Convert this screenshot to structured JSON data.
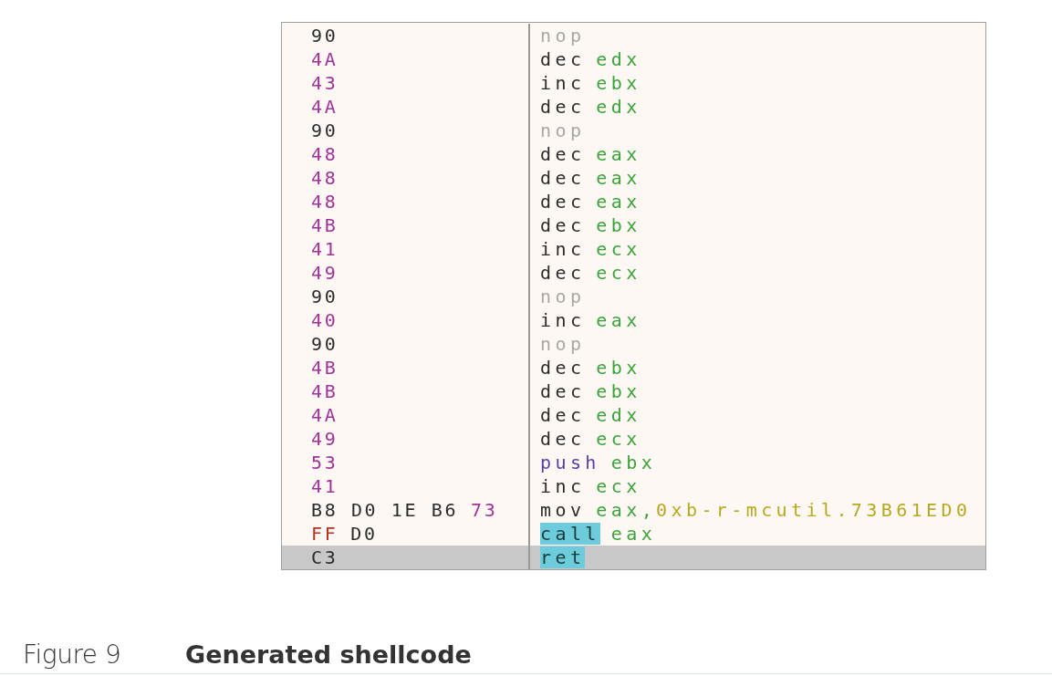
{
  "disassembly": {
    "rows": [
      {
        "bytes": [
          {
            "text": "90",
            "color": "#2b2b2b"
          }
        ],
        "mnemonic": {
          "text": "nop",
          "color": "#a8a8a8",
          "highlighted": false
        },
        "operands": [],
        "selected": false
      },
      {
        "bytes": [
          {
            "text": "4A",
            "color": "#a0329a"
          }
        ],
        "mnemonic": {
          "text": "dec",
          "color": "#2b2b2b",
          "highlighted": false
        },
        "operands": [
          {
            "text": "edx",
            "color": "#3aa43a"
          }
        ],
        "selected": false
      },
      {
        "bytes": [
          {
            "text": "43",
            "color": "#a0329a"
          }
        ],
        "mnemonic": {
          "text": "inc",
          "color": "#2b2b2b",
          "highlighted": false
        },
        "operands": [
          {
            "text": "ebx",
            "color": "#3aa43a"
          }
        ],
        "selected": false
      },
      {
        "bytes": [
          {
            "text": "4A",
            "color": "#a0329a"
          }
        ],
        "mnemonic": {
          "text": "dec",
          "color": "#2b2b2b",
          "highlighted": false
        },
        "operands": [
          {
            "text": "edx",
            "color": "#3aa43a"
          }
        ],
        "selected": false
      },
      {
        "bytes": [
          {
            "text": "90",
            "color": "#2b2b2b"
          }
        ],
        "mnemonic": {
          "text": "nop",
          "color": "#a8a8a8",
          "highlighted": false
        },
        "operands": [],
        "selected": false
      },
      {
        "bytes": [
          {
            "text": "48",
            "color": "#a0329a"
          }
        ],
        "mnemonic": {
          "text": "dec",
          "color": "#2b2b2b",
          "highlighted": false
        },
        "operands": [
          {
            "text": "eax",
            "color": "#3aa43a"
          }
        ],
        "selected": false
      },
      {
        "bytes": [
          {
            "text": "48",
            "color": "#a0329a"
          }
        ],
        "mnemonic": {
          "text": "dec",
          "color": "#2b2b2b",
          "highlighted": false
        },
        "operands": [
          {
            "text": "eax",
            "color": "#3aa43a"
          }
        ],
        "selected": false
      },
      {
        "bytes": [
          {
            "text": "48",
            "color": "#a0329a"
          }
        ],
        "mnemonic": {
          "text": "dec",
          "color": "#2b2b2b",
          "highlighted": false
        },
        "operands": [
          {
            "text": "eax",
            "color": "#3aa43a"
          }
        ],
        "selected": false
      },
      {
        "bytes": [
          {
            "text": "4B",
            "color": "#a0329a"
          }
        ],
        "mnemonic": {
          "text": "dec",
          "color": "#2b2b2b",
          "highlighted": false
        },
        "operands": [
          {
            "text": "ebx",
            "color": "#3aa43a"
          }
        ],
        "selected": false
      },
      {
        "bytes": [
          {
            "text": "41",
            "color": "#a0329a"
          }
        ],
        "mnemonic": {
          "text": "inc",
          "color": "#2b2b2b",
          "highlighted": false
        },
        "operands": [
          {
            "text": "ecx",
            "color": "#3aa43a"
          }
        ],
        "selected": false
      },
      {
        "bytes": [
          {
            "text": "49",
            "color": "#a0329a"
          }
        ],
        "mnemonic": {
          "text": "dec",
          "color": "#2b2b2b",
          "highlighted": false
        },
        "operands": [
          {
            "text": "ecx",
            "color": "#3aa43a"
          }
        ],
        "selected": false
      },
      {
        "bytes": [
          {
            "text": "90",
            "color": "#2b2b2b"
          }
        ],
        "mnemonic": {
          "text": "nop",
          "color": "#a8a8a8",
          "highlighted": false
        },
        "operands": [],
        "selected": false
      },
      {
        "bytes": [
          {
            "text": "40",
            "color": "#a0329a"
          }
        ],
        "mnemonic": {
          "text": "inc",
          "color": "#2b2b2b",
          "highlighted": false
        },
        "operands": [
          {
            "text": "eax",
            "color": "#3aa43a"
          }
        ],
        "selected": false
      },
      {
        "bytes": [
          {
            "text": "90",
            "color": "#2b2b2b"
          }
        ],
        "mnemonic": {
          "text": "nop",
          "color": "#a8a8a8",
          "highlighted": false
        },
        "operands": [],
        "selected": false
      },
      {
        "bytes": [
          {
            "text": "4B",
            "color": "#a0329a"
          }
        ],
        "mnemonic": {
          "text": "dec",
          "color": "#2b2b2b",
          "highlighted": false
        },
        "operands": [
          {
            "text": "ebx",
            "color": "#3aa43a"
          }
        ],
        "selected": false
      },
      {
        "bytes": [
          {
            "text": "4B",
            "color": "#a0329a"
          }
        ],
        "mnemonic": {
          "text": "dec",
          "color": "#2b2b2b",
          "highlighted": false
        },
        "operands": [
          {
            "text": "ebx",
            "color": "#3aa43a"
          }
        ],
        "selected": false
      },
      {
        "bytes": [
          {
            "text": "4A",
            "color": "#a0329a"
          }
        ],
        "mnemonic": {
          "text": "dec",
          "color": "#2b2b2b",
          "highlighted": false
        },
        "operands": [
          {
            "text": "edx",
            "color": "#3aa43a"
          }
        ],
        "selected": false
      },
      {
        "bytes": [
          {
            "text": "49",
            "color": "#a0329a"
          }
        ],
        "mnemonic": {
          "text": "dec",
          "color": "#2b2b2b",
          "highlighted": false
        },
        "operands": [
          {
            "text": "ecx",
            "color": "#3aa43a"
          }
        ],
        "selected": false
      },
      {
        "bytes": [
          {
            "text": "53",
            "color": "#a0329a"
          }
        ],
        "mnemonic": {
          "text": "push",
          "color": "#5a3ea8",
          "highlighted": false
        },
        "operands": [
          {
            "text": "ebx",
            "color": "#3aa43a"
          }
        ],
        "selected": false
      },
      {
        "bytes": [
          {
            "text": "41",
            "color": "#a0329a"
          }
        ],
        "mnemonic": {
          "text": "inc",
          "color": "#2b2b2b",
          "highlighted": false
        },
        "operands": [
          {
            "text": "ecx",
            "color": "#3aa43a"
          }
        ],
        "selected": false
      },
      {
        "bytes": [
          {
            "text": "B8 D0 1E B6",
            "color": "#2b2b2b"
          },
          {
            "text": "73",
            "color": "#a0329a"
          }
        ],
        "mnemonic": {
          "text": "mov",
          "color": "#2b2b2b",
          "highlighted": false
        },
        "operands": [
          {
            "text": "eax,",
            "color": "#3aa43a"
          },
          {
            "text": "0xb-r-mcutil.73B61ED0",
            "color": "#b8a820"
          }
        ],
        "selected": false
      },
      {
        "bytes": [
          {
            "text": "FF",
            "color": "#c03020"
          },
          {
            "text": "D0",
            "color": "#2b2b2b"
          }
        ],
        "mnemonic": {
          "text": "call",
          "highlighted": true
        },
        "operands": [
          {
            "text": "eax",
            "color": "#3aa43a"
          }
        ],
        "selected": false
      },
      {
        "bytes": [
          {
            "text": "C3",
            "color": "#2b2b2b"
          }
        ],
        "mnemonic": {
          "text": "ret",
          "highlighted": true
        },
        "operands": [],
        "selected": true
      }
    ]
  },
  "caption": {
    "label": "Figure 9",
    "title": "Generated shellcode"
  }
}
